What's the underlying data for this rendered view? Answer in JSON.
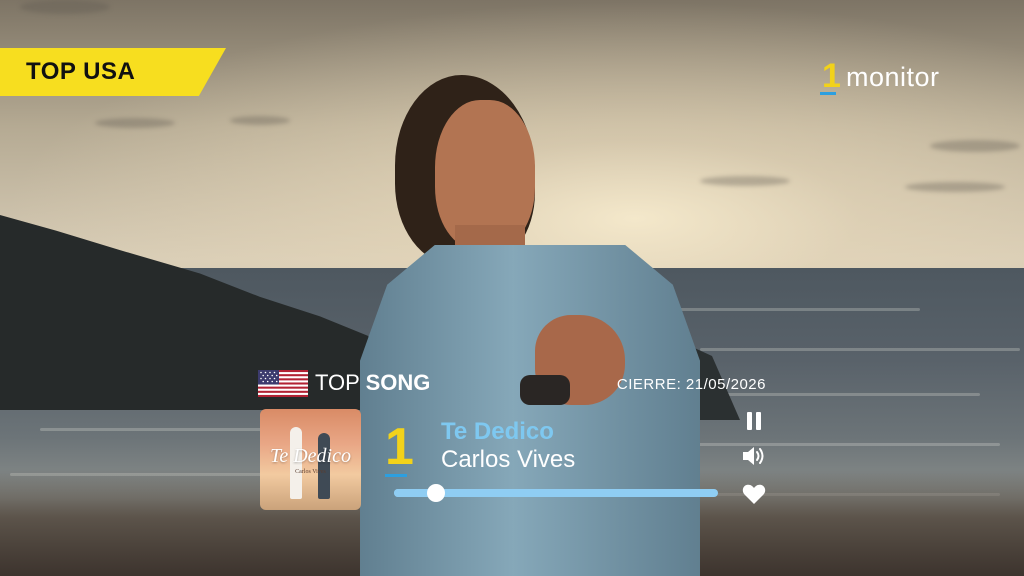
{
  "badge": {
    "label": "TOP USA"
  },
  "brand": {
    "logo_numeral": "1",
    "logo_text": "monitor",
    "accent_yellow": "#f2d21a",
    "accent_blue": "#2c9fe0"
  },
  "player": {
    "flag_icon": "us-flag-icon",
    "section_prefix": "TOP",
    "section_strong": "SONG",
    "closing": "CIERRE: 21/05/2026",
    "rank": "1",
    "song_title": "Te Dedico",
    "artist": "Carlos Vives",
    "cover": {
      "title": "Te Dedico",
      "artist": "Carlos Vives"
    },
    "progress": 0.13,
    "controls": {
      "pause": "pause-icon",
      "volume": "volume-icon",
      "like": "heart-icon"
    },
    "title_color": "#7ec8f0",
    "progress_color": "#8fcdf3"
  }
}
